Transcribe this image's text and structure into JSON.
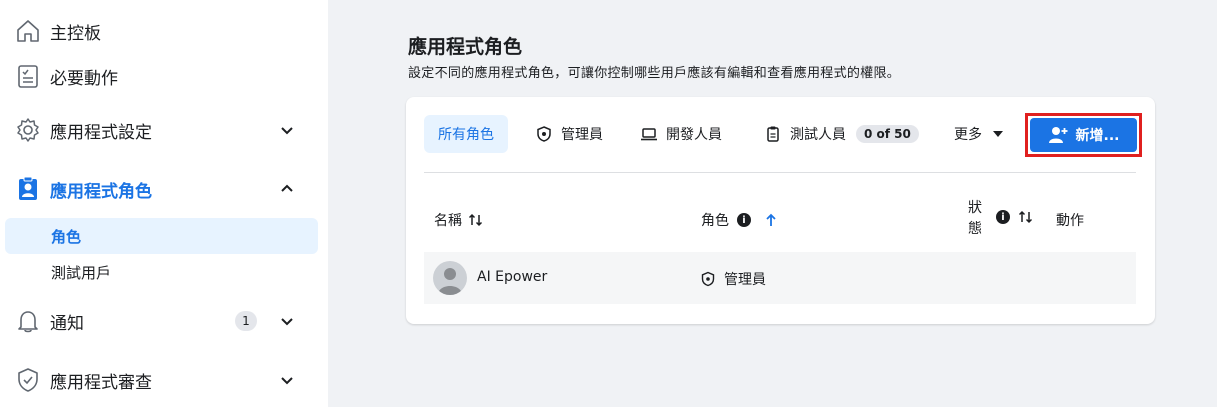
{
  "sidebar": {
    "items": [
      {
        "label": "主控板",
        "icon": "home-icon"
      },
      {
        "label": "必要動作",
        "icon": "checklist-icon"
      },
      {
        "label": "應用程式設定",
        "icon": "gear-icon"
      },
      {
        "label": "應用程式角色",
        "icon": "roles-icon"
      },
      {
        "label": "通知",
        "icon": "bell-icon",
        "badge": "1"
      },
      {
        "label": "應用程式審查",
        "icon": "shield-check-icon"
      }
    ],
    "sub_items": [
      {
        "label": "角色"
      },
      {
        "label": "測試用戶"
      }
    ]
  },
  "main": {
    "title": "應用程式角色",
    "subtitle": "設定不同的應用程式角色，可讓你控制哪些用戶應該有編輯和查看應用程式的權限。",
    "tabs": [
      {
        "label": "所有角色"
      },
      {
        "label": "管理員",
        "icon": "shield-icon"
      },
      {
        "label": "開發人員",
        "icon": "laptop-icon"
      },
      {
        "label": "測試人員",
        "icon": "clipboard-icon",
        "count": "0 of 50"
      },
      {
        "label": "更多",
        "icon": "caret-down-icon"
      }
    ],
    "add_button": "新增...",
    "table": {
      "headers": {
        "name": "名稱",
        "role": "角色",
        "status": "狀態",
        "status_line1": "狀",
        "status_line2": "態",
        "actions": "動作"
      },
      "rows": [
        {
          "name": "AI Epower",
          "role": "管理員"
        }
      ]
    }
  },
  "colors": {
    "accent": "#1b74e4",
    "highlight": "#e0201f",
    "selected_bg": "#e7f3ff"
  }
}
